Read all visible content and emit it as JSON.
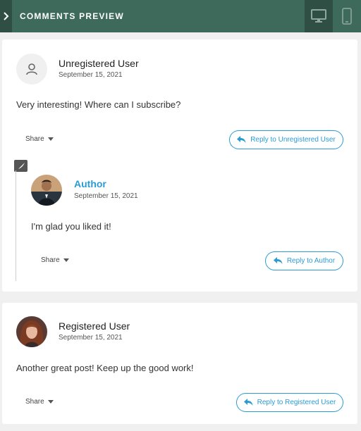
{
  "header": {
    "title": "COMMENTS PREVIEW"
  },
  "comments": [
    {
      "name": "Unregistered User",
      "date": "September 15, 2021",
      "text": "Very interesting! Where can I subscribe?",
      "share_label": "Share",
      "reply_label": "Reply to Unregistered User",
      "reply": {
        "name": "Author",
        "date": "September 15, 2021",
        "text": "I'm glad you liked it!",
        "share_label": "Share",
        "reply_label": "Reply to Author"
      }
    },
    {
      "name": "Registered User",
      "date": "September 15, 2021",
      "text": "Another great post! Keep up the good work!",
      "share_label": "Share",
      "reply_label": "Reply to Registered User"
    }
  ],
  "colors": {
    "header_bg": "#3e6a5b",
    "accent": "#2b9bd6"
  }
}
